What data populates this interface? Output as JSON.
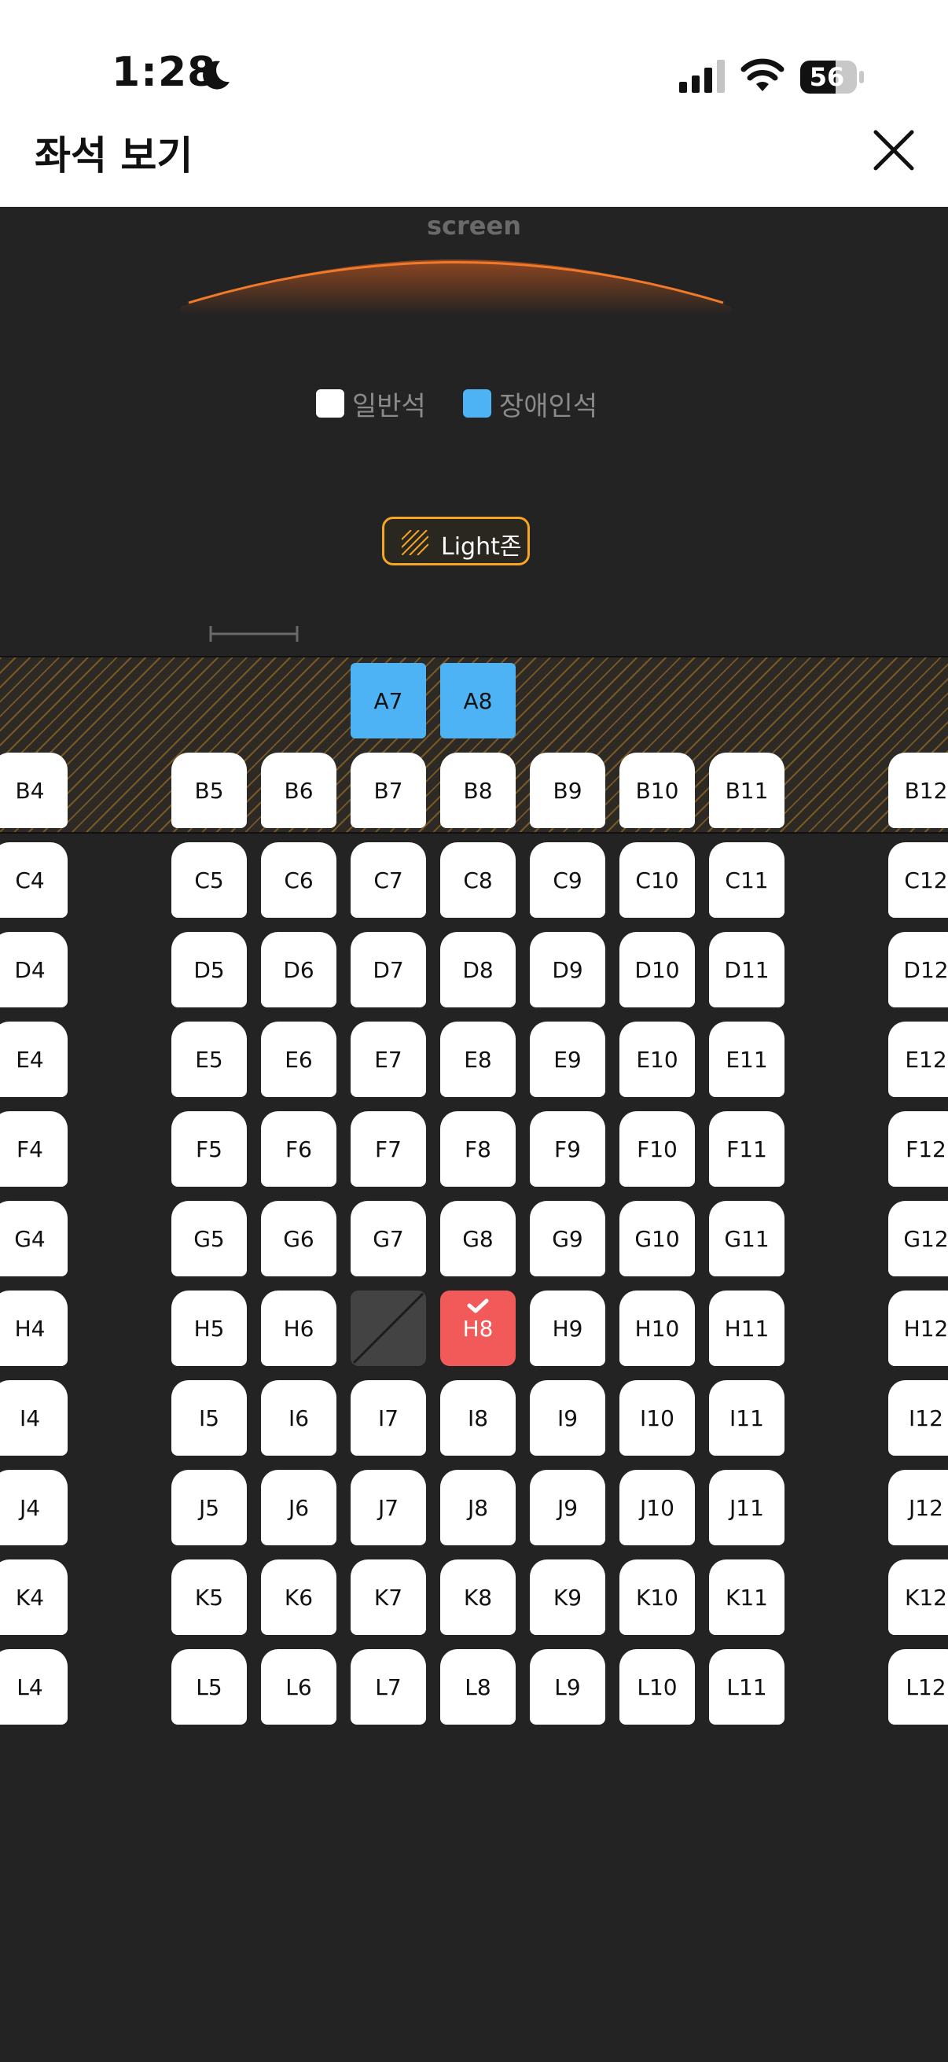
{
  "status": {
    "time": "1:28",
    "battery": "56"
  },
  "header": {
    "title": "좌석 보기"
  },
  "screen": {
    "label": "screen"
  },
  "legend": [
    {
      "label": "일반석",
      "color": "#ffffff"
    },
    {
      "label": "장애인석",
      "color": "#4db3f5"
    }
  ],
  "light_zone": {
    "label": "Light존",
    "color": "#f5a623"
  },
  "colors": {
    "background": "#232323",
    "selected": "#f25a5a",
    "accessible": "#4db3f5",
    "unavailable": "#434343"
  },
  "seats": {
    "rowA": [
      "A7",
      "A8"
    ],
    "rowB": [
      "B4",
      "B5",
      "B6",
      "B7",
      "B8",
      "B9",
      "B10",
      "B11",
      "B12"
    ],
    "rowC": [
      "C4",
      "C5",
      "C6",
      "C7",
      "C8",
      "C9",
      "C10",
      "C11",
      "C12"
    ],
    "rowD": [
      "D4",
      "D5",
      "D6",
      "D7",
      "D8",
      "D9",
      "D10",
      "D11",
      "D12"
    ],
    "rowE": [
      "E4",
      "E5",
      "E6",
      "E7",
      "E8",
      "E9",
      "E10",
      "E11",
      "E12"
    ],
    "rowF": [
      "F4",
      "F5",
      "F6",
      "F7",
      "F8",
      "F9",
      "F10",
      "F11",
      "F12"
    ],
    "rowG": [
      "G4",
      "G5",
      "G6",
      "G7",
      "G8",
      "G9",
      "G10",
      "G11",
      "G12"
    ],
    "rowH": [
      "H4",
      "H5",
      "H6",
      "",
      "H8",
      "H9",
      "H10",
      "H11",
      "H12"
    ],
    "rowI": [
      "I4",
      "I5",
      "I6",
      "I7",
      "I8",
      "I9",
      "I10",
      "I11",
      "I12"
    ],
    "rowJ": [
      "J4",
      "J5",
      "J6",
      "J7",
      "J8",
      "J9",
      "J10",
      "J11",
      "J12"
    ],
    "rowK": [
      "K4",
      "K5",
      "K6",
      "K7",
      "K8",
      "K9",
      "K10",
      "K11",
      "K12"
    ],
    "rowL": [
      "L4",
      "L5",
      "L6",
      "L7",
      "L8",
      "L9",
      "L10",
      "L11",
      "L12"
    ]
  },
  "seat_state": {
    "selected": "H8",
    "unavailable": "H7",
    "accessible": [
      "A7",
      "A8"
    ]
  }
}
